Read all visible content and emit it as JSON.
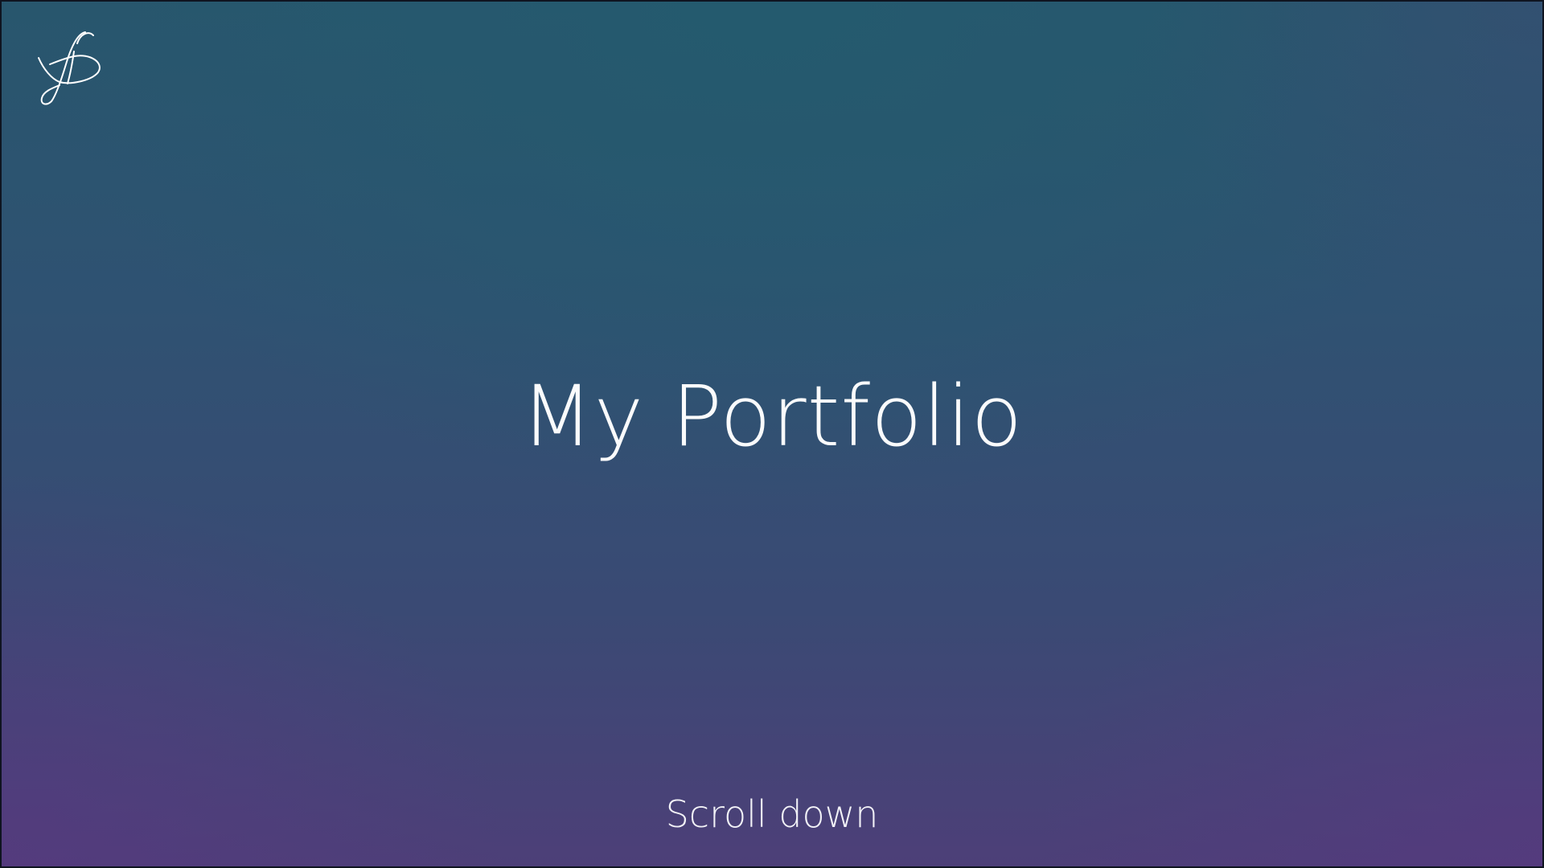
{
  "hero": {
    "title": "My Portfolio",
    "scroll_label": "Scroll down"
  },
  "logo": {
    "icon": "signature-logo-icon"
  },
  "colors": {
    "text": "#ffffff",
    "background_top": "#245a6e",
    "background_bottom": "#4d3f78"
  }
}
